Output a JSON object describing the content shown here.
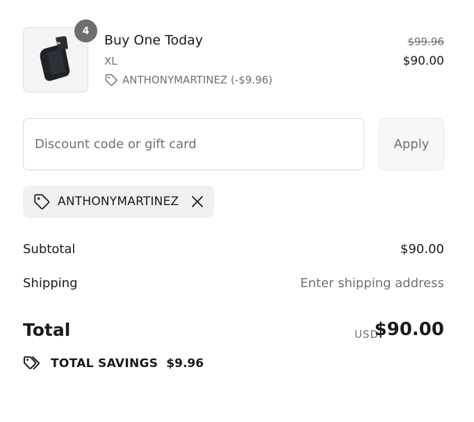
{
  "product": {
    "quantity": "4",
    "title": "Buy One Today",
    "variant": "XL",
    "discount_text": "ANTHONYMARTINEZ (-$9.96)",
    "compare_price": "$99.96",
    "price": "$90.00"
  },
  "discount": {
    "placeholder": "Discount code or gift card",
    "apply_label": "Apply",
    "applied_code": "ANTHONYMARTINEZ"
  },
  "summary": {
    "subtotal_label": "Subtotal",
    "subtotal_value": "$90.00",
    "shipping_label": "Shipping",
    "shipping_value": "Enter shipping address",
    "total_label": "Total",
    "total_currency": "USD",
    "total_value": "$90.00",
    "savings_label": "TOTAL SAVINGS",
    "savings_value": "$9.96"
  },
  "icons": {
    "tag": "tag-icon",
    "close": "close-icon",
    "savings": "tags-icon"
  }
}
